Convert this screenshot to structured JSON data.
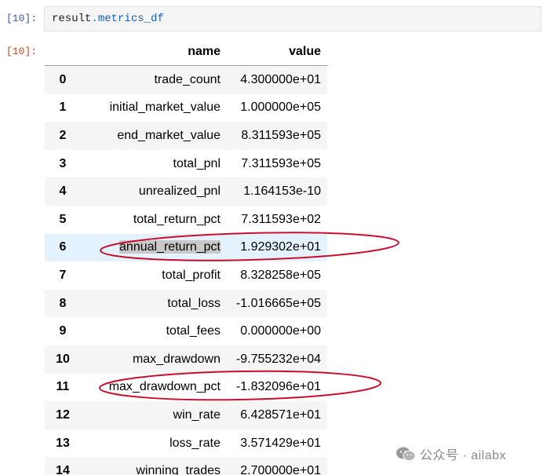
{
  "cell": {
    "in_prompt": "[10]:",
    "out_prompt": "[10]:",
    "code": {
      "object": "result",
      "dot": ".",
      "attribute": "metrics_df"
    }
  },
  "dataframe": {
    "columns": [
      "",
      "name",
      "value"
    ],
    "rows": [
      {
        "index": "0",
        "name": "trade_count",
        "value": "4.300000e+01"
      },
      {
        "index": "1",
        "name": "initial_market_value",
        "value": "1.000000e+05"
      },
      {
        "index": "2",
        "name": "end_market_value",
        "value": "8.311593e+05"
      },
      {
        "index": "3",
        "name": "total_pnl",
        "value": "7.311593e+05"
      },
      {
        "index": "4",
        "name": "unrealized_pnl",
        "value": "1.164153e-10"
      },
      {
        "index": "5",
        "name": "total_return_pct",
        "value": "7.311593e+02"
      },
      {
        "index": "6",
        "name": "annual_return_pct",
        "value": "1.929302e+01"
      },
      {
        "index": "7",
        "name": "total_profit",
        "value": "8.328258e+05"
      },
      {
        "index": "8",
        "name": "total_loss",
        "value": "-1.016665e+05"
      },
      {
        "index": "9",
        "name": "total_fees",
        "value": "0.000000e+00"
      },
      {
        "index": "10",
        "name": "max_drawdown",
        "value": "-9.755232e+04"
      },
      {
        "index": "11",
        "name": "max_drawdown_pct",
        "value": "-1.832096e+01"
      },
      {
        "index": "12",
        "name": "win_rate",
        "value": "6.428571e+01"
      },
      {
        "index": "13",
        "name": "loss_rate",
        "value": "3.571429e+01"
      },
      {
        "index": "14",
        "name": "winning_trades",
        "value": "2.700000e+01"
      }
    ],
    "hovered_row_index": "6",
    "selected_text": "annual_return_pct",
    "highlighted_rows": [
      "6",
      "11"
    ]
  },
  "watermark": {
    "text": "公众号 · ailabx",
    "icon": "wechat-icon"
  },
  "colors": {
    "in_prompt": "#3f51b5",
    "out_prompt": "#d84315",
    "code_attr": "#1565c0",
    "row_stripe": "#f5f5f5",
    "row_hover": "#e3f2fd",
    "annotation_red": "#c8102e"
  }
}
